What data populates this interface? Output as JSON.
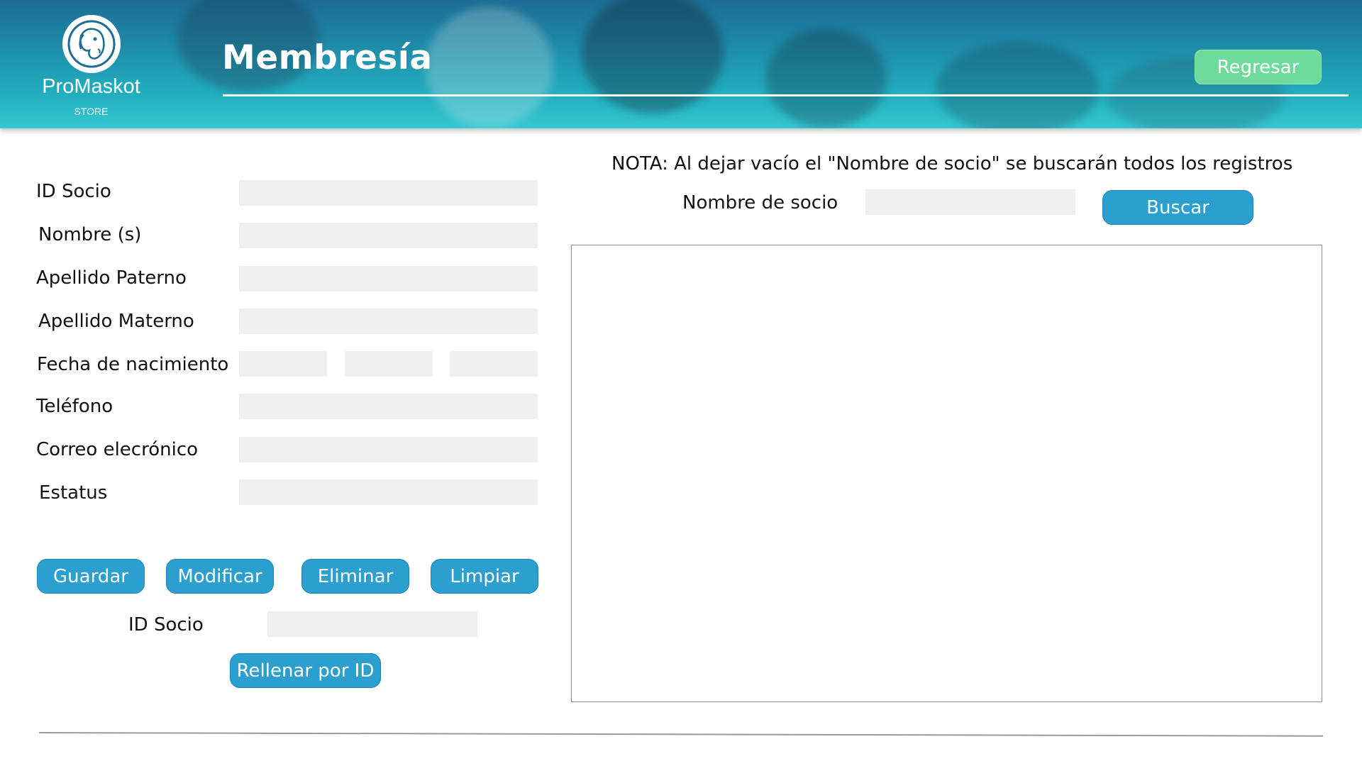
{
  "header": {
    "logo_name": "ProMaskot",
    "logo_sub": "STORE",
    "title": "Membresía",
    "back_button": "Regresar"
  },
  "form": {
    "fields": [
      {
        "label": "ID Socio",
        "value": ""
      },
      {
        "label": "Nombre (s)",
        "value": ""
      },
      {
        "label": "Apellido Paterno",
        "value": ""
      },
      {
        "label": "Apellido Materno",
        "value": ""
      },
      {
        "label": "Fecha de nacimiento",
        "value": ""
      },
      {
        "label": "Teléfono",
        "value": ""
      },
      {
        "label": "Correo elecrónico",
        "value": ""
      },
      {
        "label": "Estatus",
        "value": ""
      }
    ],
    "buttons": {
      "save": "Guardar",
      "modify": "Modificar",
      "delete": "Eliminar",
      "clear": "Limpiar"
    },
    "fill_by_id": {
      "label": "ID Socio",
      "value": "",
      "button": "Rellenar por ID"
    }
  },
  "search": {
    "note": "NOTA: Al dejar vacío el \"Nombre de socio\" se buscarán todos los registros",
    "label": "Nombre de socio",
    "value": "",
    "button": "Buscar"
  },
  "colors": {
    "header_gradient_top": "#1c6c93",
    "header_gradient_bottom": "#35c8d2",
    "primary_button": "#2a9fd0",
    "back_button": "#6edb9c",
    "field_bg": "#efefef"
  }
}
